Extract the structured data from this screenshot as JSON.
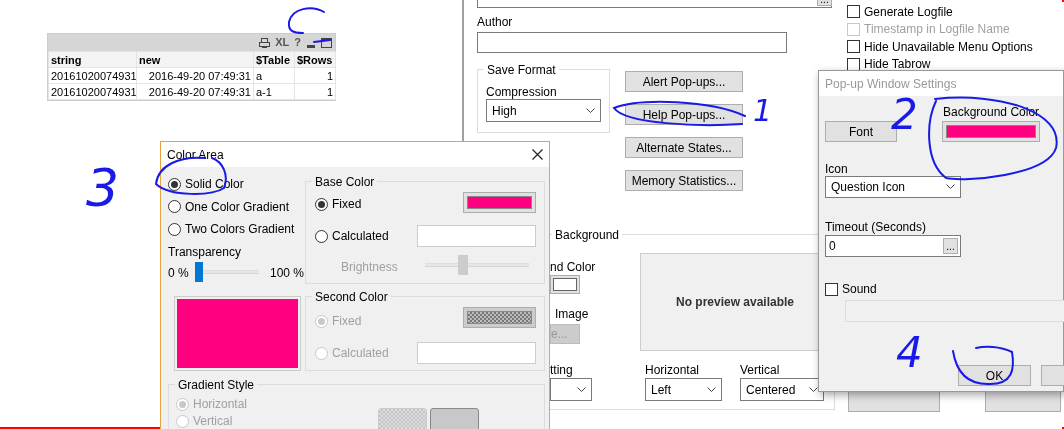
{
  "data_table": {
    "toolbar_glyphs": [
      "XL",
      "?"
    ],
    "columns": [
      "string",
      "new",
      "$Table",
      "$Rows"
    ],
    "rows": [
      [
        "20161020074931",
        "2016-49-20 07:49:31",
        "a",
        "1"
      ],
      [
        "20161020074931",
        "2016-49-20 07:49:31",
        "a-1",
        "1"
      ]
    ]
  },
  "document_properties": {
    "field_button": "...",
    "author_label": "Author",
    "save_format": {
      "title": "Save Format",
      "compression_label": "Compression",
      "compression": "High"
    },
    "buttons": [
      "Alert Pop-ups...",
      "Help Pop-ups...",
      "Alternate States...",
      "Memory Statistics..."
    ],
    "options": [
      {
        "label": "Generate Logfile",
        "checked": false,
        "disabled": false
      },
      {
        "label": "Timestamp in Logfile Name",
        "checked": false,
        "disabled": true
      },
      {
        "label": "Hide Unavailable Menu Options",
        "checked": false,
        "disabled": false
      },
      {
        "label": "Hide Tabrow",
        "checked": false,
        "disabled": false
      }
    ],
    "background": {
      "title": "Background",
      "color_label": "nd Color",
      "image_label": "Image",
      "image_button": "e...",
      "fitting_label": "tting",
      "horizontal_label": "Horizontal",
      "horizontal": "Left",
      "vertical_label": "Vertical",
      "vertical": "Centered",
      "preview": "No preview available"
    }
  },
  "color_area": {
    "title": "Color Area",
    "modes": [
      {
        "label": "Solid Color",
        "selected": true
      },
      {
        "label": "One Color Gradient",
        "selected": false
      },
      {
        "label": "Two Colors Gradient",
        "selected": false
      }
    ],
    "transparency_label": "Transparency",
    "transparency_min": "0 %",
    "transparency_max": "100 %",
    "transparency": {
      "level": 0
    },
    "base_color": {
      "title": "Base Color",
      "options": [
        {
          "label": "Fixed",
          "selected": true,
          "disabled": false
        },
        {
          "label": "Calculated",
          "selected": false,
          "disabled": false
        }
      ],
      "brightness_label": "Brightness",
      "brightness": {
        "level": 0.35,
        "disabled": true
      }
    },
    "second_color": {
      "title": "Second Color",
      "options": [
        {
          "label": "Fixed",
          "selected": true,
          "disabled": true
        },
        {
          "label": "Calculated",
          "selected": false,
          "disabled": true
        }
      ]
    },
    "gradient_style": {
      "title": "Gradient Style",
      "options": [
        {
          "label": "Horizontal",
          "selected": true,
          "disabled": true
        },
        {
          "label": "Vertical",
          "selected": false,
          "disabled": true
        }
      ]
    }
  },
  "popup_settings": {
    "title": "Pop-up Window Settings",
    "font_button": "Font",
    "background_color_label": "Background Color",
    "icon_label": "Icon",
    "icon": "Question Icon",
    "timeout_label": "Timeout (Seconds)",
    "timeout": "0",
    "timeout_button": "...",
    "sound": {
      "label": "Sound",
      "checked": false
    },
    "ok_button": "OK"
  },
  "annotations": [
    "1",
    "2",
    "3",
    "4"
  ]
}
